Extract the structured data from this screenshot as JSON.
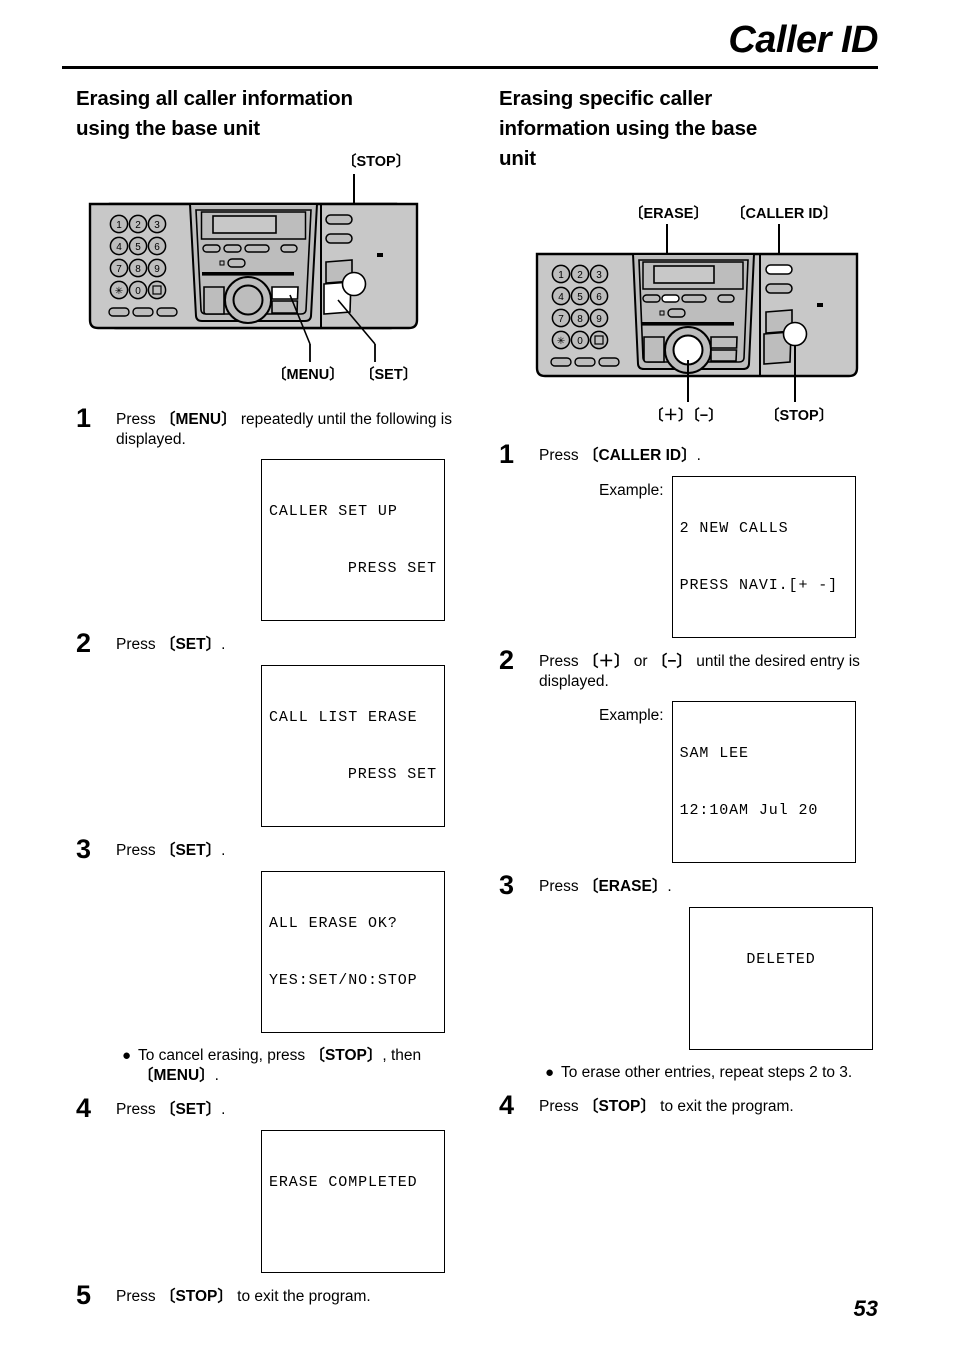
{
  "header": {
    "title": "Caller ID"
  },
  "footer": {
    "page_number": "53"
  },
  "left_column": {
    "section_title_line1": "Erasing all caller information",
    "section_title_line2": "using the base unit",
    "figure": {
      "callouts": {
        "stop": "〔STOP〕",
        "menu": "〔MENU〕",
        "set": "〔SET〕"
      },
      "keypad": [
        "1",
        "2",
        "3",
        "4",
        "5",
        "6",
        "7",
        "8",
        "9",
        "✱",
        "0",
        "⏏"
      ]
    },
    "steps": [
      {
        "num": "1",
        "text_before": "Press ",
        "key": "〔MENU〕",
        "text_after": " repeatedly until the following is displayed.",
        "lcd_line1": "CALLER SET UP",
        "lcd_line2": "PRESS SET"
      },
      {
        "num": "2",
        "text_before": "Press ",
        "key": "〔SET〕",
        "text_after": ".",
        "lcd_line1": "CALL LIST ERASE",
        "lcd_line2": "PRESS SET"
      },
      {
        "num": "3",
        "text_before": "Press ",
        "key": "〔SET〕",
        "text_after": ".",
        "lcd_line1": "ALL ERASE OK?",
        "lcd_line2": "YES:SET/NO:STOP"
      },
      {
        "num": "4",
        "text_before": "Press ",
        "key": "〔SET〕",
        "text_after": ".",
        "lcd_line1": "ERASE COMPLETED",
        "lcd_line2": ""
      },
      {
        "num": "5",
        "text_before": "Press ",
        "key": "〔STOP〕",
        "text_after": " to exit the program."
      }
    ],
    "note": {
      "bullet": "●",
      "part1": "To cancel erasing, press ",
      "key1": "〔STOP〕",
      "part2": ", then ",
      "key2": "〔MENU〕",
      "part3": "."
    }
  },
  "right_column": {
    "section_title_line1": "Erasing specific caller",
    "section_title_line2": "information using the base",
    "section_title_line3": "unit",
    "figure": {
      "callouts": {
        "erase": "〔ERASE〕",
        "caller_id": "〔CALLER ID〕",
        "plus_minus": "〔＋〕〔−〕",
        "stop": "〔STOP〕"
      },
      "keypad": [
        "1",
        "2",
        "3",
        "4",
        "5",
        "6",
        "7",
        "8",
        "9",
        "✱",
        "0",
        "⏏"
      ]
    },
    "steps": [
      {
        "num": "1",
        "text_before": "Press ",
        "key": "〔CALLER ID〕",
        "text_after": ".",
        "example_label": "Example:",
        "lcd_line1": "2 NEW CALLS",
        "lcd_line2": "PRESS NAVI.[+ -]"
      },
      {
        "num": "2",
        "text_before": "Press ",
        "key": "〔＋〕",
        "text_mid": " or ",
        "key2": "〔−〕",
        "text_after": " until the desired entry is displayed.",
        "example_label": "Example:",
        "lcd_line1": "SAM LEE",
        "lcd_line2": "12:10AM Jul 20"
      },
      {
        "num": "3",
        "text_before": "Press ",
        "key": "〔ERASE〕",
        "text_after": ".",
        "lcd_line1": "DELETED",
        "lcd_line2": ""
      },
      {
        "num": "4",
        "text_before": "Press ",
        "key": "〔STOP〕",
        "text_after": " to exit the program."
      }
    ],
    "note": {
      "bullet": "●",
      "part1": "To erase other entries, repeat steps 2 to 3."
    }
  },
  "colors": {
    "body_fill": "#c8c8c8",
    "panel_fill": "#bdbdbd",
    "highlight_fill": "#ffffff",
    "outline": "#000000"
  }
}
